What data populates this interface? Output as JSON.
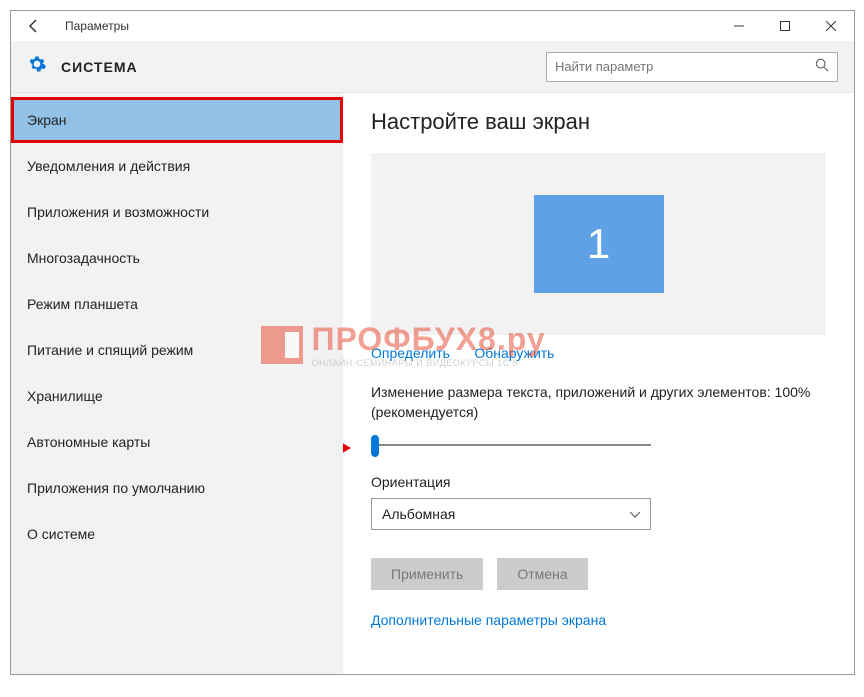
{
  "titlebar": {
    "title": "Параметры"
  },
  "header": {
    "title": "СИСТЕМА",
    "search_placeholder": "Найти параметр"
  },
  "sidebar": {
    "items": [
      {
        "label": "Экран",
        "selected": true
      },
      {
        "label": "Уведомления и действия"
      },
      {
        "label": "Приложения и возможности"
      },
      {
        "label": "Многозадачность"
      },
      {
        "label": "Режим планшета"
      },
      {
        "label": "Питание и спящий режим"
      },
      {
        "label": "Хранилище"
      },
      {
        "label": "Автономные карты"
      },
      {
        "label": "Приложения по умолчанию"
      },
      {
        "label": "О системе"
      }
    ]
  },
  "main": {
    "heading": "Настройте ваш экран",
    "monitor_number": "1",
    "link_identify": "Определить",
    "link_detect": "Обнаружить",
    "scale_label": "Изменение размера текста, приложений и других элементов: 100% (рекомендуется)",
    "orientation_label": "Ориентация",
    "orientation_value": "Альбомная",
    "btn_apply": "Применить",
    "btn_cancel": "Отмена",
    "advanced_link": "Дополнительные параметры экрана",
    "scale_value_percent": 100,
    "slider_position": 0
  },
  "watermark": {
    "main": "ПРОФБУХ8.ру",
    "sub": "ОНЛАЙН-СЕМИНАРЫ И ВИДЕОКУРСЫ 1С 8"
  }
}
